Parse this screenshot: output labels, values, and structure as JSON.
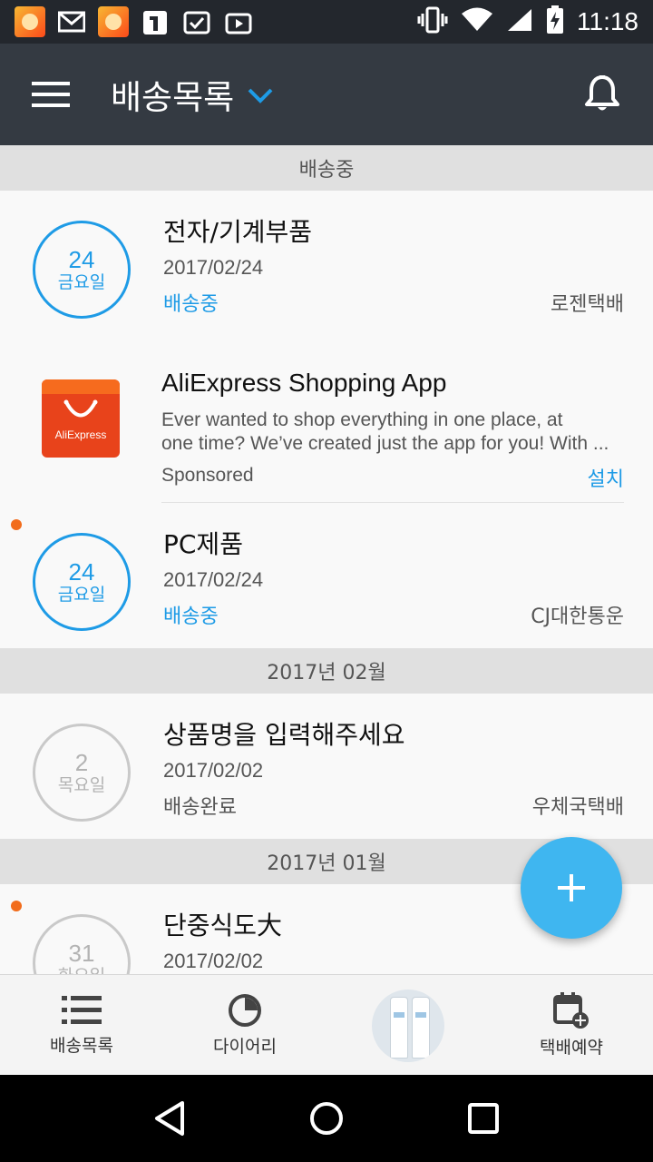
{
  "status_bar": {
    "time": "11:18"
  },
  "app_bar": {
    "title": "배송목록"
  },
  "sections": [
    {
      "header": "배송중",
      "items": [
        {
          "day": "24",
          "weekday": "금요일",
          "title": "전자/기계부품",
          "date": "2017/02/24",
          "status": "배송중",
          "courier": "로젠택배",
          "unread": false
        }
      ]
    }
  ],
  "ad": {
    "logo_text": "AliExpress",
    "title": "AliExpress Shopping App",
    "description_line1": "Ever wanted to shop everything in one place, at",
    "description_line2": "one time? We’ve created just the app for you! With ...",
    "sponsored": "Sponsored",
    "install_label": "설치"
  },
  "item_pc": {
    "day": "24",
    "weekday": "금요일",
    "title": "PC제품",
    "date": "2017/02/24",
    "status": "배송중",
    "courier": "CJ대한통운",
    "unread": true
  },
  "section_feb": {
    "header": "2017년 02월",
    "item": {
      "day": "2",
      "weekday": "목요일",
      "title": "상품명을 입력해주세요",
      "date": "2017/02/02",
      "status": "배송완료",
      "courier": "우체국택배",
      "unread": false
    }
  },
  "section_jan": {
    "header": "2017년 01월",
    "item": {
      "day": "31",
      "weekday": "화요일",
      "title": "단중식도大",
      "date": "2017/02/02",
      "unread": true
    }
  },
  "bottom_nav": {
    "items": [
      {
        "label": "배송목록",
        "icon": "list-icon"
      },
      {
        "label": "다이어리",
        "icon": "pie-chart-icon"
      },
      {
        "label": "",
        "icon": "ad-product-image"
      },
      {
        "label": "택배예약",
        "icon": "calendar-add-icon"
      }
    ]
  },
  "colors": {
    "accent": "#1e9be6",
    "app_bar": "#343a42",
    "fab": "#3fb6f0",
    "unread_dot": "#f26c1b"
  }
}
